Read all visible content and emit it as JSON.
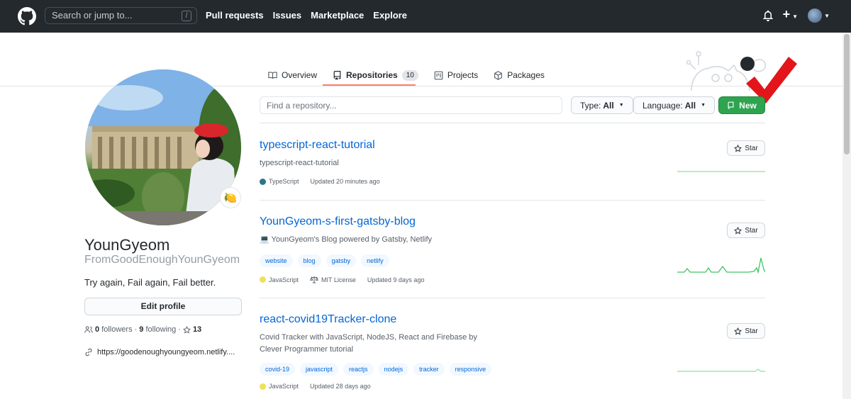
{
  "header": {
    "search_placeholder": "Search or jump to...",
    "search_shortcut": "/",
    "nav": [
      "Pull requests",
      "Issues",
      "Marketplace",
      "Explore"
    ],
    "plus": "+"
  },
  "tabs": [
    {
      "label": "Overview",
      "icon": "book-open-icon"
    },
    {
      "label": "Repositories",
      "icon": "repo-icon",
      "count": "10",
      "active": true
    },
    {
      "label": "Projects",
      "icon": "project-icon"
    },
    {
      "label": "Packages",
      "icon": "package-icon"
    }
  ],
  "profile": {
    "status_emoji": "🍋",
    "fullname": "YounGyeom",
    "username": "FromGoodEnoughYounGyeom",
    "bio": "Try again, Fail again, Fail better.",
    "edit_button": "Edit profile",
    "followers_count": "0",
    "followers_label": "followers",
    "following_count": "9",
    "following_label": "following",
    "separator": "·",
    "stars_count": "13",
    "website": "https://goodenoughyoungyeom.netlify...."
  },
  "filters": {
    "find_placeholder": "Find a repository...",
    "type_label": "Type:",
    "type_value": "All",
    "language_label": "Language:",
    "language_value": "All",
    "new_button": "New"
  },
  "repos": [
    {
      "name": "typescript-react-tutorial",
      "description": "typescript-react-tutorial",
      "language": "TypeScript",
      "language_color": "#2b7489",
      "updated": "Updated 20 minutes ago",
      "star_label": "Star"
    },
    {
      "name": "YounGyeom-s-first-gatsby-blog",
      "description": "💻 YounGyeom's Blog powered by Gatsby, Netlify",
      "topics": [
        "website",
        "blog",
        "gatsby",
        "netlify"
      ],
      "language": "JavaScript",
      "language_color": "#f1e05a",
      "license": "MIT License",
      "updated": "Updated 9 days ago",
      "star_label": "Star"
    },
    {
      "name": "react-covid19Tracker-clone",
      "description": "Covid Tracker with JavaScript, NodeJS, React and Firebase by Clever Programmer tutorial",
      "topics": [
        "covid-19",
        "javascript",
        "reactjs",
        "nodejs",
        "tracker",
        "responsive"
      ],
      "language": "JavaScript",
      "language_color": "#f1e05a",
      "updated": "Updated 28 days ago",
      "star_label": "Star"
    }
  ]
}
